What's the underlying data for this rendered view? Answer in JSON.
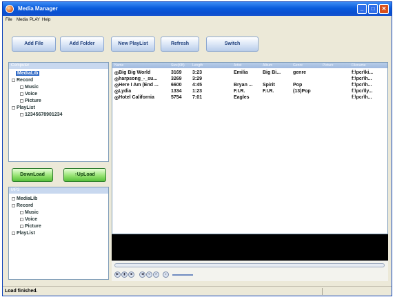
{
  "window": {
    "title": "Media Manager"
  },
  "menu": [
    "File",
    "Media",
    "PLAY",
    "Help"
  ],
  "toolbar": {
    "add_file": "Add File",
    "add_folder": "Add Folder",
    "new_playlist": "New PlayList",
    "refresh": "Refresh",
    "switch": "Switch"
  },
  "computer_panel": {
    "header": "Computer",
    "items": [
      "MediaLib",
      "Record",
      "Music",
      "Voice",
      "Picture",
      "PlayList",
      "12345678901234"
    ]
  },
  "transfer": {
    "download": "DownLoad",
    "upload": "UpLoad"
  },
  "mp3_panel": {
    "header": "MP3",
    "items": [
      "MediaLib",
      "Record",
      "Music",
      "Voice",
      "Picture",
      "PlayList"
    ]
  },
  "file_list": {
    "columns": [
      "Name",
      "Size(KB)",
      "Length",
      "Artist",
      "Album",
      "Genre",
      "Picture",
      "Filename"
    ],
    "rows": [
      [
        "Big Big World",
        "3169",
        "3:23",
        "Emilia",
        "Big Bi...",
        "genre",
        "",
        "f:\\pcr\\ki..."
      ],
      [
        "harpsong_-_su...",
        "3269",
        "3:29",
        "",
        "",
        "",
        "",
        "f:\\pcr\\h..."
      ],
      [
        "Here I Am (End ...",
        "6600",
        "4:45",
        "Bryan ...",
        "Spirit",
        "Pop",
        "",
        "f:\\pcr\\h..."
      ],
      [
        "Lydia",
        "1334",
        "1:23",
        "F.I.R.",
        "F.I.R.",
        "(13)Pop",
        "",
        "f:\\pcr\\ly..."
      ],
      [
        "Hotel California",
        "5754",
        "7:01",
        "Eagles",
        "",
        "",
        "",
        "f:\\pcr\\h..."
      ]
    ]
  },
  "status": {
    "text": "Load finished."
  }
}
